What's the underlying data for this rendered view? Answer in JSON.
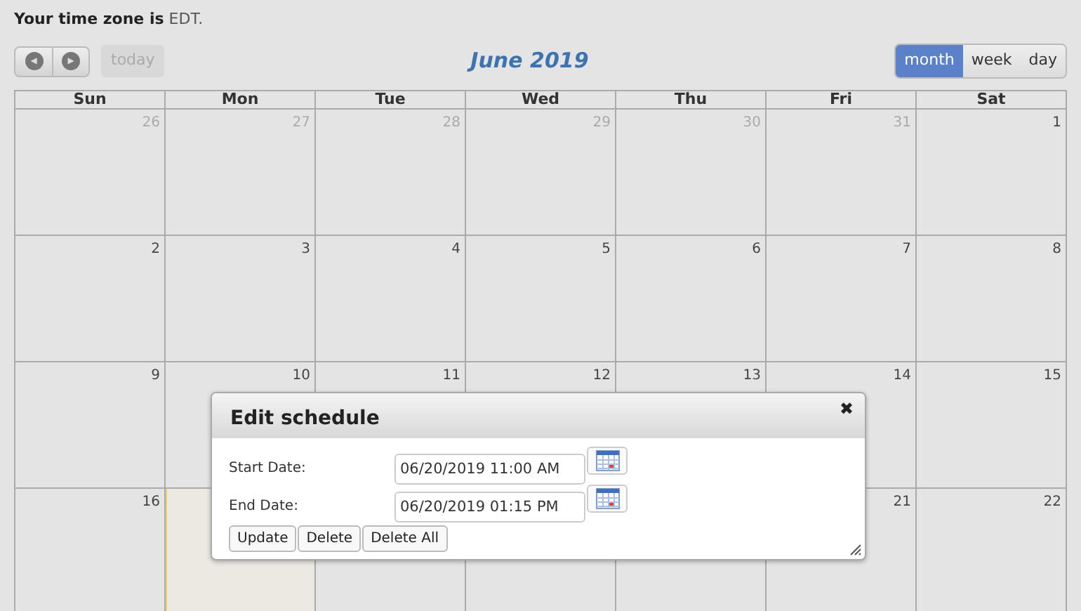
{
  "timezone": {
    "label": "**Your time zone is** EDT."
  },
  "toolbar": {
    "prev": "◀",
    "next": "▶",
    "today": {
      "label": "today",
      "disabled": true
    },
    "title": "June 2019",
    "views": [
      {
        "label": "month",
        "selected": true
      },
      {
        "label": "week",
        "selected": false
      },
      {
        "label": "day",
        "selected": false
      }
    ]
  },
  "calendar": {
    "weekdays": [
      "Sun",
      "Mon",
      "Tue",
      "Wed",
      "Thu",
      "Fri",
      "Sat"
    ],
    "weeks": [
      [
        {
          "number": "26",
          "other_month": true,
          "today": false
        },
        {
          "number": "27",
          "other_month": true,
          "today": false
        },
        {
          "number": "28",
          "other_month": true,
          "today": false
        },
        {
          "number": "29",
          "other_month": true,
          "today": false
        },
        {
          "number": "30",
          "other_month": true,
          "today": false
        },
        {
          "number": "31",
          "other_month": true,
          "today": false
        },
        {
          "number": "1",
          "other_month": false,
          "today": false
        }
      ],
      [
        {
          "number": "2",
          "other_month": false,
          "today": false
        },
        {
          "number": "3",
          "other_month": false,
          "today": false
        },
        {
          "number": "4",
          "other_month": false,
          "today": false
        },
        {
          "number": "5",
          "other_month": false,
          "today": false
        },
        {
          "number": "6",
          "other_month": false,
          "today": false
        },
        {
          "number": "7",
          "other_month": false,
          "today": false
        },
        {
          "number": "8",
          "other_month": false,
          "today": false
        }
      ],
      [
        {
          "number": "9",
          "other_month": false,
          "today": false
        },
        {
          "number": "10",
          "other_month": false,
          "today": false
        },
        {
          "number": "11",
          "other_month": false,
          "today": false
        },
        {
          "number": "12",
          "other_month": false,
          "today": false
        },
        {
          "number": "13",
          "other_month": false,
          "today": false
        },
        {
          "number": "14",
          "other_month": false,
          "today": false
        },
        {
          "number": "15",
          "other_month": false,
          "today": false
        }
      ],
      [
        {
          "number": "16",
          "other_month": false,
          "today": false
        },
        {
          "today": true
        },
        {
          "today": false
        },
        {
          "today": false
        },
        {
          "today": false
        },
        {
          "number": "21",
          "other_month": false,
          "today": false
        },
        {
          "number": "22",
          "other_month": false,
          "today": false
        }
      ]
    ]
  },
  "dialog": {
    "title": "Edit schedule",
    "close": "✖",
    "fields": [
      {
        "label": "Start Date:",
        "value": "06/20/2019 11:00 AM"
      },
      {
        "label": "End Date:",
        "value": "06/20/2019 01:15 PM"
      }
    ],
    "buttons": [
      "Update",
      "Delete",
      "Delete All"
    ]
  }
}
